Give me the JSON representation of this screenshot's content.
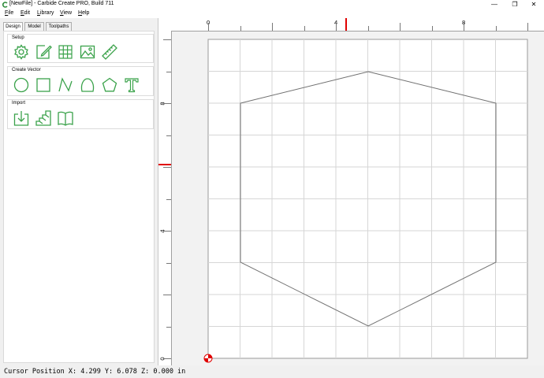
{
  "window": {
    "title": "[NewFile] - Carbide Create PRO, Build 711",
    "controls": [
      {
        "name": "minimize",
        "glyph": "—"
      },
      {
        "name": "restore",
        "glyph": "❐"
      },
      {
        "name": "close",
        "glyph": "✕"
      }
    ]
  },
  "menu": [
    "File",
    "Edit",
    "Library",
    "View",
    "Help"
  ],
  "tabs": [
    {
      "label": "Design",
      "active": true
    },
    {
      "label": "Model",
      "active": false
    },
    {
      "label": "Toolpaths",
      "active": false
    }
  ],
  "groups": {
    "setup": {
      "label": "Setup",
      "tools": [
        "gear-icon",
        "edit-document-icon",
        "grid-icon",
        "image-icon",
        "ruler-icon"
      ]
    },
    "create_vector": {
      "label": "Create Vector",
      "tools": [
        "circle-icon",
        "rectangle-icon",
        "polyline-icon",
        "curve-icon",
        "polygon-icon",
        "text-icon"
      ]
    },
    "import": {
      "label": "Import",
      "tools": [
        "import-icon",
        "stairs-icon",
        "book-icon"
      ]
    }
  },
  "rulers": {
    "top_labels": [
      "0",
      "4",
      "8"
    ],
    "left_labels": [
      "8",
      "4",
      "0"
    ]
  },
  "colors": {
    "icon_green": "#3aa24a",
    "marker_red": "#e00000",
    "grid": "#d6d6d6",
    "shape": "#707070"
  },
  "status": {
    "text": "Cursor Position X: 4.299 Y: 6.078 Z: 0.000 in"
  }
}
